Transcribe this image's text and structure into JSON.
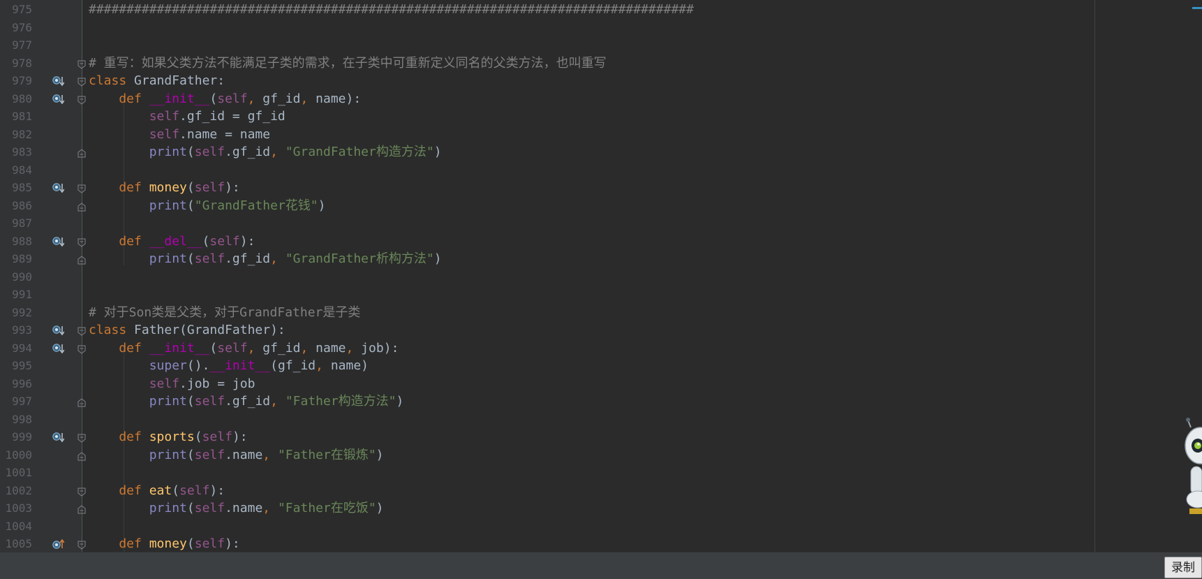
{
  "lines": [
    {
      "n": "975",
      "gi": "",
      "fold": "",
      "tokens": [
        {
          "t": "################################################################################",
          "c": "cm"
        }
      ]
    },
    {
      "n": "976",
      "gi": "",
      "fold": "",
      "tokens": []
    },
    {
      "n": "977",
      "gi": "",
      "fold": "",
      "tokens": []
    },
    {
      "n": "978",
      "gi": "",
      "fold": "start",
      "tokens": [
        {
          "t": "# 重写：如果父类方法不能满足子类的需求，在子类中可重新定义同名的父类方法，也叫重写",
          "c": "cm"
        }
      ]
    },
    {
      "n": "979",
      "gi": "down",
      "fold": "start",
      "tokens": [
        {
          "t": "class ",
          "c": "kw"
        },
        {
          "t": "GrandFather:",
          "c": ""
        }
      ]
    },
    {
      "n": "980",
      "gi": "down",
      "fold": "start",
      "tokens": [
        {
          "t": "    def ",
          "c": "kw"
        },
        {
          "t": "__init__",
          "c": "mg"
        },
        {
          "t": "(",
          "c": ""
        },
        {
          "t": "self",
          "c": "slf"
        },
        {
          "t": ", ",
          "c": "pn"
        },
        {
          "t": "gf_id",
          "c": ""
        },
        {
          "t": ", ",
          "c": "pn"
        },
        {
          "t": "name):",
          "c": ""
        }
      ]
    },
    {
      "n": "981",
      "gi": "",
      "fold": "",
      "tokens": [
        {
          "t": "        self",
          "c": "slf"
        },
        {
          "t": ".gf_id = gf_id",
          "c": ""
        }
      ]
    },
    {
      "n": "982",
      "gi": "",
      "fold": "",
      "tokens": [
        {
          "t": "        self",
          "c": "slf"
        },
        {
          "t": ".name = name",
          "c": ""
        }
      ]
    },
    {
      "n": "983",
      "gi": "",
      "fold": "end",
      "tokens": [
        {
          "t": "        print",
          "c": "bi"
        },
        {
          "t": "(",
          "c": ""
        },
        {
          "t": "self",
          "c": "slf"
        },
        {
          "t": ".gf_id",
          "c": ""
        },
        {
          "t": ", ",
          "c": "pn"
        },
        {
          "t": "\"GrandFather构造方法\"",
          "c": "str"
        },
        {
          "t": ")",
          "c": ""
        }
      ]
    },
    {
      "n": "984",
      "gi": "",
      "fold": "",
      "tokens": []
    },
    {
      "n": "985",
      "gi": "down",
      "fold": "start",
      "tokens": [
        {
          "t": "    def ",
          "c": "kw"
        },
        {
          "t": "money",
          "c": "fn"
        },
        {
          "t": "(",
          "c": ""
        },
        {
          "t": "self",
          "c": "slf"
        },
        {
          "t": "):",
          "c": ""
        }
      ]
    },
    {
      "n": "986",
      "gi": "",
      "fold": "end",
      "tokens": [
        {
          "t": "        print",
          "c": "bi"
        },
        {
          "t": "(",
          "c": ""
        },
        {
          "t": "\"GrandFather花钱\"",
          "c": "str"
        },
        {
          "t": ")",
          "c": ""
        }
      ]
    },
    {
      "n": "987",
      "gi": "",
      "fold": "",
      "tokens": []
    },
    {
      "n": "988",
      "gi": "down",
      "fold": "start",
      "tokens": [
        {
          "t": "    def ",
          "c": "kw"
        },
        {
          "t": "__del__",
          "c": "mg"
        },
        {
          "t": "(",
          "c": ""
        },
        {
          "t": "self",
          "c": "slf"
        },
        {
          "t": "):",
          "c": ""
        }
      ]
    },
    {
      "n": "989",
      "gi": "",
      "fold": "end",
      "tokens": [
        {
          "t": "        print",
          "c": "bi"
        },
        {
          "t": "(",
          "c": ""
        },
        {
          "t": "self",
          "c": "slf"
        },
        {
          "t": ".gf_id",
          "c": ""
        },
        {
          "t": ", ",
          "c": "pn"
        },
        {
          "t": "\"GrandFather析构方法\"",
          "c": "str"
        },
        {
          "t": ")",
          "c": ""
        }
      ]
    },
    {
      "n": "990",
      "gi": "",
      "fold": "",
      "tokens": []
    },
    {
      "n": "991",
      "gi": "",
      "fold": "",
      "tokens": []
    },
    {
      "n": "992",
      "gi": "",
      "fold": "",
      "tokens": [
        {
          "t": "# 对于Son类是父类，对于GrandFather是子类",
          "c": "cm"
        }
      ]
    },
    {
      "n": "993",
      "gi": "down",
      "fold": "start",
      "tokens": [
        {
          "t": "class ",
          "c": "kw"
        },
        {
          "t": "Father(GrandFather):",
          "c": ""
        }
      ]
    },
    {
      "n": "994",
      "gi": "down",
      "fold": "start",
      "tokens": [
        {
          "t": "    def ",
          "c": "kw"
        },
        {
          "t": "__init__",
          "c": "mg"
        },
        {
          "t": "(",
          "c": ""
        },
        {
          "t": "self",
          "c": "slf"
        },
        {
          "t": ", ",
          "c": "pn"
        },
        {
          "t": "gf_id",
          "c": ""
        },
        {
          "t": ", ",
          "c": "pn"
        },
        {
          "t": "name",
          "c": ""
        },
        {
          "t": ", ",
          "c": "pn"
        },
        {
          "t": "job):",
          "c": ""
        }
      ]
    },
    {
      "n": "995",
      "gi": "",
      "fold": "",
      "tokens": [
        {
          "t": "        super",
          "c": "bi"
        },
        {
          "t": "().",
          "c": ""
        },
        {
          "t": "__init__",
          "c": "mg"
        },
        {
          "t": "(gf_id",
          "c": ""
        },
        {
          "t": ", ",
          "c": "pn"
        },
        {
          "t": "name)",
          "c": ""
        }
      ]
    },
    {
      "n": "996",
      "gi": "",
      "fold": "",
      "tokens": [
        {
          "t": "        self",
          "c": "slf"
        },
        {
          "t": ".job = job",
          "c": ""
        }
      ]
    },
    {
      "n": "997",
      "gi": "",
      "fold": "end",
      "tokens": [
        {
          "t": "        print",
          "c": "bi"
        },
        {
          "t": "(",
          "c": ""
        },
        {
          "t": "self",
          "c": "slf"
        },
        {
          "t": ".gf_id",
          "c": ""
        },
        {
          "t": ", ",
          "c": "pn"
        },
        {
          "t": "\"Father构造方法\"",
          "c": "str"
        },
        {
          "t": ")",
          "c": ""
        }
      ]
    },
    {
      "n": "998",
      "gi": "",
      "fold": "",
      "tokens": []
    },
    {
      "n": "999",
      "gi": "down",
      "fold": "start",
      "tokens": [
        {
          "t": "    def ",
          "c": "kw"
        },
        {
          "t": "sports",
          "c": "fn"
        },
        {
          "t": "(",
          "c": ""
        },
        {
          "t": "self",
          "c": "slf"
        },
        {
          "t": "):",
          "c": ""
        }
      ]
    },
    {
      "n": "1000",
      "gi": "",
      "fold": "end",
      "tokens": [
        {
          "t": "        print",
          "c": "bi"
        },
        {
          "t": "(",
          "c": ""
        },
        {
          "t": "self",
          "c": "slf"
        },
        {
          "t": ".name",
          "c": ""
        },
        {
          "t": ", ",
          "c": "pn"
        },
        {
          "t": "\"Father在锻炼\"",
          "c": "str"
        },
        {
          "t": ")",
          "c": ""
        }
      ]
    },
    {
      "n": "1001",
      "gi": "",
      "fold": "",
      "tokens": []
    },
    {
      "n": "1002",
      "gi": "",
      "fold": "start",
      "tokens": [
        {
          "t": "    def ",
          "c": "kw"
        },
        {
          "t": "eat",
          "c": "fn"
        },
        {
          "t": "(",
          "c": ""
        },
        {
          "t": "self",
          "c": "slf"
        },
        {
          "t": "):",
          "c": ""
        }
      ]
    },
    {
      "n": "1003",
      "gi": "",
      "fold": "end",
      "tokens": [
        {
          "t": "        print",
          "c": "bi"
        },
        {
          "t": "(",
          "c": ""
        },
        {
          "t": "self",
          "c": "slf"
        },
        {
          "t": ".name",
          "c": ""
        },
        {
          "t": ", ",
          "c": "pn"
        },
        {
          "t": "\"Father在吃饭\"",
          "c": "str"
        },
        {
          "t": ")",
          "c": ""
        }
      ]
    },
    {
      "n": "1004",
      "gi": "",
      "fold": "",
      "tokens": []
    },
    {
      "n": "1005",
      "gi": "up",
      "fold": "start",
      "tokens": [
        {
          "t": "    def ",
          "c": "kw"
        },
        {
          "t": "money",
          "c": "fn"
        },
        {
          "t": "(",
          "c": ""
        },
        {
          "t": "self",
          "c": "slf"
        },
        {
          "t": "):",
          "c": ""
        }
      ]
    }
  ],
  "record_button": {
    "label": "录制"
  },
  "icons": {
    "override_down": "overridden-method-icon",
    "override_up": "overriding-method-icon",
    "fold": "fold-marker-icon",
    "mascot": "assistant-robot-icon"
  },
  "colors": {
    "background": "#2b2b2b",
    "gutter": "#313335",
    "keyword": "#cc7832",
    "string": "#6a8759",
    "comment": "#808080",
    "self": "#94558d",
    "magic": "#b200b2",
    "function": "#ffc66d",
    "builtin": "#8888c6",
    "text": "#a9b7c6"
  }
}
